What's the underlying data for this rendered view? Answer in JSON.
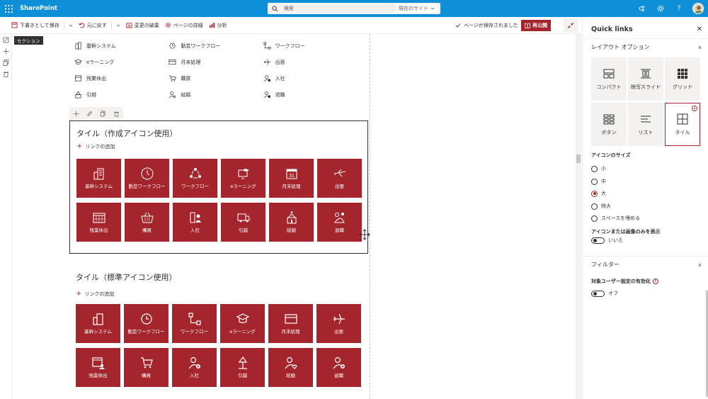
{
  "topbar": {
    "brand": "SharePoint",
    "search_placeholder": "検索",
    "search_scope": "現在のサイト"
  },
  "cmdbar": {
    "save_draft": "下書きとして保存",
    "undo": "元に戻す",
    "discard": "変更の破棄",
    "page_details": "ページの詳細",
    "analytics": "分析",
    "saved_status": "ページが保存されました",
    "republish": "再公開"
  },
  "section_tooltip": "セクション",
  "links_list": [
    [
      "基幹システム",
      "勤怠ワークフロー",
      "ワークフロー"
    ],
    [
      "eラーニング",
      "月末処理",
      "出張"
    ],
    [
      "残業休出",
      "購買",
      "入社"
    ],
    [
      "引越",
      "結婚",
      "退職"
    ]
  ],
  "webpart1": {
    "title": "タイル（作成アイコン使用）",
    "add_link": "リンクの追加",
    "tiles": [
      "基幹システム",
      "勤怠ワークフロー",
      "ワークフロー",
      "eラーニング",
      "月末処理",
      "出張",
      "残業休出",
      "購買",
      "入社",
      "引越",
      "結婚",
      "退職"
    ]
  },
  "webpart2": {
    "title": "タイル（標準アイコン使用）",
    "add_link": "リンクの追加",
    "tiles": [
      "基幹システム",
      "勤怠ワークフロー",
      "ワークフロー",
      "eラーニング",
      "月末処理",
      "出張",
      "残業休出",
      "購買",
      "入社",
      "引越",
      "結婚",
      "退職"
    ]
  },
  "panel": {
    "title": "Quick links",
    "layout_section": "レイアウト オプション",
    "layouts": [
      "コンパクト",
      "映写スライド",
      "グリッド",
      "ボタン",
      "リスト",
      "タイル"
    ],
    "selected_layout": "タイル",
    "icon_size_label": "アイコンのサイズ",
    "icon_sizes": [
      "小",
      "中",
      "大",
      "特大",
      "スペースを埋める"
    ],
    "selected_icon_size": "大",
    "icon_only_label": "アイコンまたは画像のみを表示",
    "icon_only_value": "いいえ",
    "filter_section": "フィルター",
    "audience_label": "対象ユーザー設定の有効化",
    "audience_value": "オフ"
  },
  "colors": {
    "suite_bar": "#0f8fd8",
    "accent": "#a4262c"
  }
}
